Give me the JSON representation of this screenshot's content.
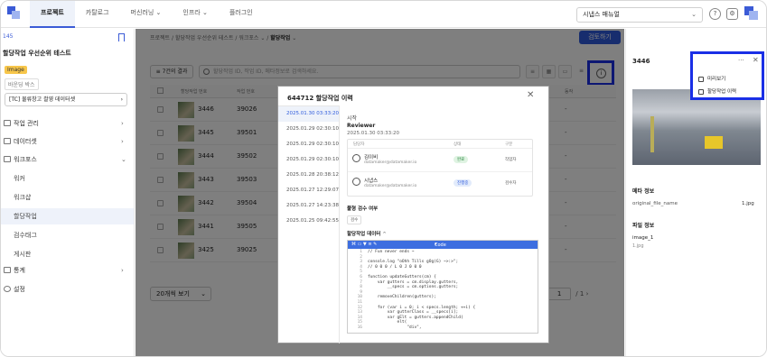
{
  "topbar": {
    "nav": [
      "프로젝트",
      "카탈로그",
      "머신러닝",
      "인프라",
      "플러그인"
    ],
    "manual_select": "시냅스 매뉴얼",
    "help_icon": "?"
  },
  "sidebar": {
    "project_id": "145",
    "project_title": "할당작업 우선순위 테스트",
    "badge": "Image",
    "box_label": "바운딩 박스",
    "dataset": "[TC] 물류창고 촬영 데이터셋",
    "menu": {
      "task_management": "작업 관리",
      "dataset": "데이터셋",
      "workforce": "워크포스",
      "worker": "워커",
      "workgroup": "워크샵",
      "assignment": "할당작업",
      "review_tag": "검수태그",
      "board": "게시판",
      "stats": "통계",
      "settings": "설정"
    }
  },
  "main": {
    "breadcrumb": [
      "프로젝트",
      "할당작업 우선순위 테스트",
      "워크포스",
      "할당작업"
    ],
    "review_button": "검토하기",
    "filter_label": "7건의 결과",
    "search_placeholder": "할당작업 ID, 작업 ID, 메타정보로 검색하세요.",
    "headers": {
      "assignment_no": "할당작업 번호",
      "work_no": "작업 번호",
      "status": "동작"
    },
    "rows": [
      {
        "id": "3446",
        "work": "39026",
        "dash": "-"
      },
      {
        "id": "3445",
        "work": "39501",
        "dash": "-"
      },
      {
        "id": "3444",
        "work": "39502",
        "dash": "-"
      },
      {
        "id": "3443",
        "work": "39503",
        "dash": "-"
      },
      {
        "id": "3442",
        "work": "39504",
        "dash": "-"
      },
      {
        "id": "3441",
        "work": "39505",
        "dash": "-"
      },
      {
        "id": "3425",
        "work": "39025",
        "dash": "-"
      }
    ],
    "page_size": "20개씩 보기",
    "page_current": "1",
    "page_total": "/ 1"
  },
  "modal": {
    "title": "644712 할당작업 이력",
    "dates": [
      "2025.01.30 03:33:20",
      "2025.01.29 02:30:10",
      "2025.01.29 02:30:10",
      "2025.01.29 02:30:10",
      "2025.01.28 20:38:12",
      "2025.01.27 12:29:07",
      "2025.01.27 14:23:38",
      "2025.01.25 09:42:55"
    ],
    "event_type": "시작",
    "event_role": "Reviewer",
    "event_time": "2025.01.30 03:33:20",
    "people_headers": {
      "name": "담당자",
      "status": "상태",
      "role": "구분"
    },
    "people": [
      {
        "name": "김이비",
        "email": "datamaker@datamaker.io",
        "status": "완료",
        "role": "작업자"
      },
      {
        "name": "시냅스",
        "email": "datamaker@datamaker.io",
        "status": "진행중",
        "role": "검수자"
      }
    ],
    "review_required_label": "풀형 검수 여부",
    "review_required_value": "검수",
    "data_label": "할당작업 데이터",
    "code_toolbar": "Code",
    "code_lines": [
      "// Fun never ends ~",
      "",
      "console.log \"oOhh Tills gOg(G) ~>:>\";",
      "// 0 0 0 / L 0 J 0 0 0",
      "",
      "function updateGutters(cm) {",
      "    var gutters = cm.display.gutters,",
      "        __specs = cm.options.gutters;",
      "",
      "    removeChildren(gutters);",
      "",
      "    for (var i = 0; i < specs.length; ++i) {",
      "        var gutterClass = __specs[i];",
      "        var gElt = gutters.appendChild(",
      "            elt(",
      "                \"div\","
    ]
  },
  "right_panel": {
    "asset_id": "3446",
    "meta_title": "메타 정보",
    "meta_key": "original_file_name",
    "meta_value": "1.jpg",
    "file_title": "파일 정보",
    "file_name": "image_1",
    "file_ext": "1.jpg"
  },
  "popup": {
    "options": [
      "미리보기",
      "할당작업 이력"
    ]
  },
  "colors": {
    "accent": "#2f5bdc",
    "highlight": "#1a2fe6"
  }
}
